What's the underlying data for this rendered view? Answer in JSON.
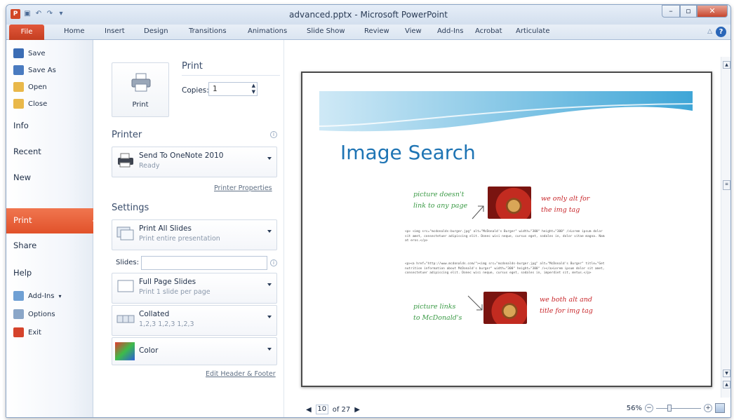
{
  "window": {
    "title": "advanced.pptx - Microsoft PowerPoint",
    "app_letter": "P",
    "qat_icons": [
      "save-icon",
      "undo-icon",
      "redo-icon"
    ]
  },
  "ribbon_tabs": [
    "File",
    "Home",
    "Insert",
    "Design",
    "Transitions",
    "Animations",
    "Slide Show",
    "Review",
    "View",
    "Add-Ins",
    "Acrobat",
    "Articulate"
  ],
  "nav": {
    "commands_top": [
      {
        "label": "Save",
        "icon": "save-icon",
        "color": "#3b6db5"
      },
      {
        "label": "Save As",
        "icon": "save-as-icon",
        "color": "#4a7bc0"
      },
      {
        "label": "Open",
        "icon": "open-folder-icon",
        "color": "#e9b84a"
      },
      {
        "label": "Close",
        "icon": "close-folder-icon",
        "color": "#e9b84a"
      }
    ],
    "tabs": [
      "Info",
      "Recent",
      "New",
      "Print",
      "Share",
      "Help"
    ],
    "active": "Print",
    "commands_bottom": [
      {
        "label": "Add-Ins",
        "icon": "add-ins-icon",
        "color": "#6fa0d4"
      },
      {
        "label": "Options",
        "icon": "options-icon",
        "color": "#8aa6c8"
      },
      {
        "label": "Exit",
        "icon": "exit-icon",
        "color": "#d5432c"
      }
    ]
  },
  "print": {
    "button_label": "Print",
    "heading": "Print",
    "copies_label": "Copies:",
    "copies_value": "1"
  },
  "printer": {
    "section_title": "Printer",
    "name": "Send To OneNote 2010",
    "status": "Ready",
    "properties_link": "Printer Properties"
  },
  "settings": {
    "section_title": "Settings",
    "range_title": "Print All Slides",
    "range_sub": "Print entire presentation",
    "slides_label": "Slides:",
    "slides_value": "",
    "layout_title": "Full Page Slides",
    "layout_sub": "Print 1 slide per page",
    "collate_title": "Collated",
    "collate_sub": "1,2,3   1,2,3   1,2,3",
    "color_title": "Color",
    "header_footer_link": "Edit Header & Footer"
  },
  "preview": {
    "slide_title": "Image Search",
    "note_green_1": "picture doesn't\nlink to any page",
    "note_red_1": "we only alt for\nthe img tag",
    "note_green_2": "picture links\nto McDonald's",
    "note_red_2": "we both alt and\ntitle for img tag",
    "code_1": "<p> <img src=\"mcdonalds-burger.jpg\" alt=\"McDonald's Burger\" width=\"300\" height=\"300\" />Lorem ipsum dolor sit amet, consectetuer adipiscing elit. Donec wisi neque, cursus eget, sodales in, dolor vitae magna. Nam at eros.</p>",
    "code_2": "<p><a href=\"http://www.mcdonalds.com/\"><img src=\"mcdonalds-burger.jpg\" alt=\"McDonald's Burger\" title=\"Get nutrition information about McDonald's burger\" width=\"300\" height=\"300\" /></a>Lorem ipsum dolor sit amet, consectetuer adipiscing elit. Donec wisi neque, cursus eget, sodales in, imperdiet sit, metus.</p>",
    "current_page": "10",
    "of_pages": "of 27",
    "zoom": "56%",
    "zoom_fraction": 0.56
  },
  "colors": {
    "file_tab": "#d24726",
    "active_nav": "#e1522a",
    "slide_title": "#1e74b4"
  }
}
